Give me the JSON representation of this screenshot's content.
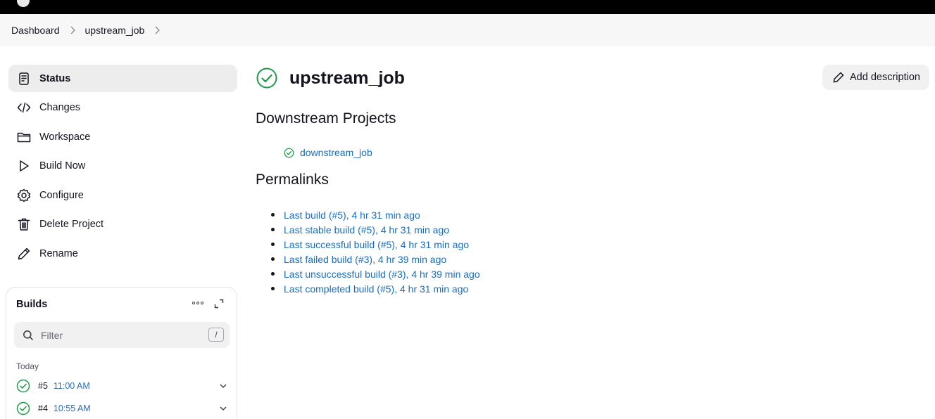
{
  "breadcrumb": {
    "items": [
      "Dashboard",
      "upstream_job"
    ]
  },
  "sidebar": {
    "items": [
      {
        "label": "Status",
        "icon": "document-icon",
        "active": true
      },
      {
        "label": "Changes",
        "icon": "code-icon"
      },
      {
        "label": "Workspace",
        "icon": "folder-icon"
      },
      {
        "label": "Build Now",
        "icon": "play-icon"
      },
      {
        "label": "Configure",
        "icon": "gear-icon"
      },
      {
        "label": "Delete Project",
        "icon": "trash-icon"
      },
      {
        "label": "Rename",
        "icon": "pencil-icon"
      }
    ]
  },
  "builds": {
    "title": "Builds",
    "filter_placeholder": "Filter",
    "filter_shortcut": "/",
    "group_label": "Today",
    "rows": [
      {
        "number": "#5",
        "time": "11:00 AM",
        "status": "success"
      },
      {
        "number": "#4",
        "time": "10:55 AM",
        "status": "success"
      }
    ]
  },
  "main": {
    "job_title": "upstream_job",
    "add_description_label": "Add description",
    "downstream_heading": "Downstream Projects",
    "downstream_projects": [
      "downstream_job"
    ],
    "permalinks_heading": "Permalinks",
    "permalinks": [
      "Last build (#5), 4 hr 31 min ago",
      "Last stable build (#5), 4 hr 31 min ago",
      "Last successful build (#5), 4 hr 31 min ago",
      "Last failed build (#3), 4 hr 39 min ago",
      "Last unsuccessful build (#3), 4 hr 39 min ago",
      "Last completed build (#5), 4 hr 31 min ago"
    ]
  },
  "colors": {
    "success": "#1e9a4a",
    "link": "#1a6dc1",
    "active_bg": "#ededee"
  }
}
